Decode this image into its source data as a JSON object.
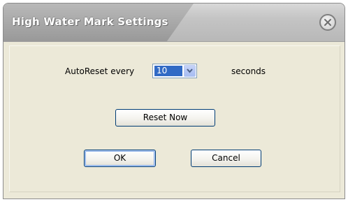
{
  "window": {
    "title": "High Water Mark Settings"
  },
  "settings": {
    "autoreset_label": "AutoReset every",
    "autoreset_value": "10",
    "seconds_label": "seconds"
  },
  "buttons": {
    "reset_now": "Reset Now",
    "ok": "OK",
    "cancel": "Cancel"
  },
  "icons": {
    "close": "close-icon",
    "dropdown": "chevron-down-icon"
  },
  "colors": {
    "selection": "#316ac5",
    "dialog_background": "#ece9d8"
  }
}
